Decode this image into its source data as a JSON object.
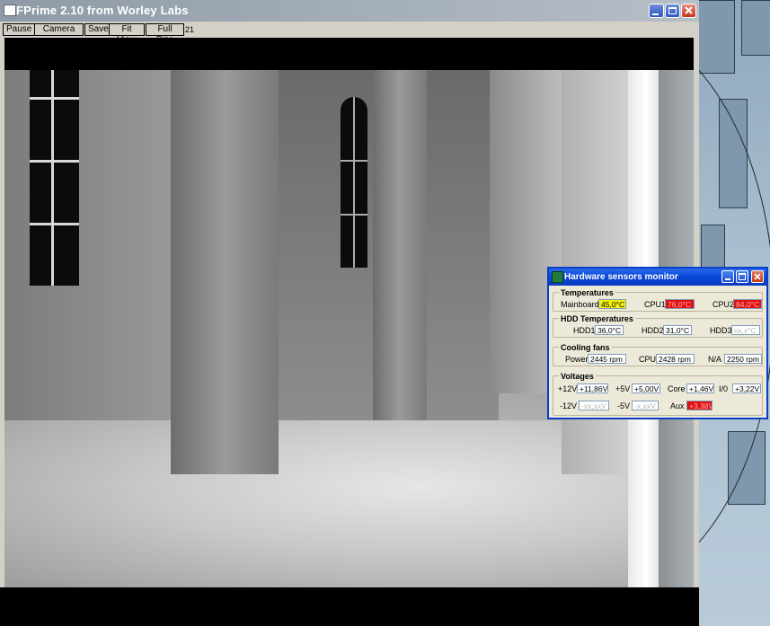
{
  "window": {
    "title": "FPrime 2.10 from Worley Labs",
    "controls": [
      "minimize",
      "maximize",
      "close"
    ]
  },
  "toolbar": {
    "buttons": [
      "Pause",
      "Camera",
      "Save",
      "Fit View",
      "Full Size"
    ],
    "frame_count": "21"
  },
  "sensors": {
    "title": "Hardware sensors monitor",
    "temperatures": {
      "heading": "Temperatures",
      "items": [
        {
          "label": "Mainboard",
          "value": "45,0°C",
          "state": "warn"
        },
        {
          "label": "CPU1",
          "value": "76,0°C",
          "state": "alarm"
        },
        {
          "label": "CPU2",
          "value": "84,0°C",
          "state": "alarm"
        }
      ]
    },
    "hdd": {
      "heading": "HDD Temperatures",
      "items": [
        {
          "label": "HDD1",
          "value": "36,0°C",
          "state": "normal"
        },
        {
          "label": "HDD2",
          "value": "31,0°C",
          "state": "normal"
        },
        {
          "label": "HDD3",
          "value": "xx,x°C",
          "state": "na"
        }
      ]
    },
    "fans": {
      "heading": "Cooling fans",
      "items": [
        {
          "label": "Power",
          "value": "2445 rpm",
          "state": "normal"
        },
        {
          "label": "CPU",
          "value": "2428 rpm",
          "state": "normal"
        },
        {
          "label": "N/A",
          "value": "2250 rpm",
          "state": "normal"
        }
      ]
    },
    "voltages": {
      "heading": "Voltages",
      "row1": [
        {
          "label": "+12V",
          "value": "+11,86V",
          "state": "normal"
        },
        {
          "label": "+5V",
          "value": "+5,00V",
          "state": "normal"
        },
        {
          "label": "Core",
          "value": "+1,46V",
          "state": "normal"
        },
        {
          "label": "I/0",
          "value": "+3,22V",
          "state": "normal"
        }
      ],
      "row2": [
        {
          "label": "-12V",
          "value": "-xx,xxV",
          "state": "na"
        },
        {
          "label": "-5V",
          "value": "-x,xxV",
          "state": "na"
        },
        {
          "label": "Aux",
          "value": "+3,38V",
          "state": "alarm"
        }
      ]
    }
  },
  "colors": {
    "warn": "#f6f20c",
    "alarm": "#e01010",
    "xp_title": "#0a47d8"
  }
}
